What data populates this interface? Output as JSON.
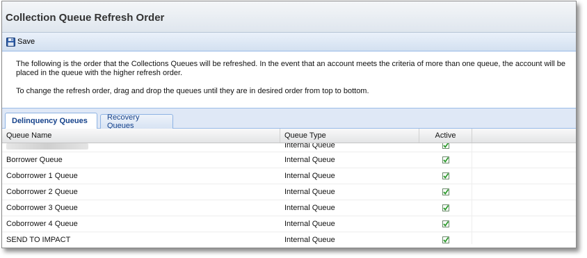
{
  "page": {
    "title": "Collection Queue Refresh Order"
  },
  "toolbar": {
    "save_label": "Save",
    "save_icon": "floppy-disk-icon"
  },
  "info": {
    "line1": "The following is the order that the Collections Queues will be refreshed. In the event that an account meets the criteria of more than one queue, the account will be placed in the queue with the higher refresh order.",
    "line2": "To change the refresh order, drag and drop the queues until they are in desired order from top to bottom."
  },
  "tabs": [
    {
      "label": "Delinquency Queues",
      "active": true
    },
    {
      "label": "Recovery Queues",
      "active": false
    }
  ],
  "grid": {
    "columns": [
      "Queue Name",
      "Queue Type",
      "Active"
    ],
    "rows": [
      {
        "name": "",
        "type": "Internal Queue",
        "active": true
      },
      {
        "name": "Borrower Queue",
        "type": "Internal Queue",
        "active": true
      },
      {
        "name": "Coborrower 1 Queue",
        "type": "Internal Queue",
        "active": true
      },
      {
        "name": "Coborrower 2 Queue",
        "type": "Internal Queue",
        "active": true
      },
      {
        "name": "Coborrower 3 Queue",
        "type": "Internal Queue",
        "active": true
      },
      {
        "name": "Coborrower 4 Queue",
        "type": "Internal Queue",
        "active": true
      },
      {
        "name": "SEND TO IMPACT",
        "type": "Internal Queue",
        "active": true
      }
    ]
  },
  "colors": {
    "accent": "#15428b",
    "check_green": "#2e9b2e",
    "tab_border": "#99bbe8"
  }
}
